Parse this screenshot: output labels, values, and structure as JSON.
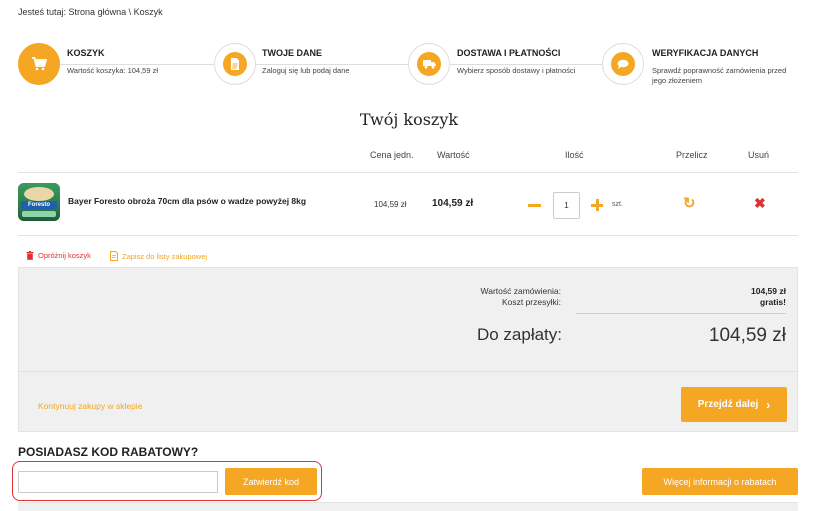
{
  "breadcrumb": {
    "prefix": "Jesteś tutaj:",
    "home": "Strona główna",
    "separator": "\\",
    "current": "Koszyk"
  },
  "steps": [
    {
      "title": "KOSZYK",
      "desc": "Wartość koszyka: 104,59 zł",
      "icon": "cart-icon",
      "active": true
    },
    {
      "title": "TWOJE DANE",
      "desc": "Zaloguj się lub podaj dane",
      "icon": "document-icon",
      "active": false
    },
    {
      "title": "DOSTAWA I PŁATNOŚCI",
      "desc": "Wybierz sposób dostawy i płatności",
      "icon": "truck-icon",
      "active": false
    },
    {
      "title": "WERYFIKACJA DANYCH",
      "desc": "Sprawdź poprawność zamówienia przed jego złożeniem",
      "icon": "speech-bubble-icon",
      "active": false
    }
  ],
  "cart_title": "Twój koszyk",
  "table": {
    "headers": {
      "unit_price": "Cena jedn.",
      "value": "Wartość",
      "quantity": "Ilość",
      "recalc": "Przelicz",
      "remove": "Usuń"
    }
  },
  "items": [
    {
      "name": "Bayer Foresto obroża 70cm dla psów o wadze powyżej 8kg",
      "image_label": "Foresto",
      "unit_price": "104,59 zł",
      "value": "104,59 zł",
      "quantity": "1",
      "unit": "szt."
    }
  ],
  "actions": {
    "empty_cart": "Opróżnij koszyk",
    "save_list": "Zapisz do listy zakupowej"
  },
  "summary": {
    "order_value_label": "Wartość zamówienia:",
    "order_value": "104,59 zł",
    "shipping_label": "Koszt przesyłki:",
    "shipping": "gratis!",
    "to_pay_label": "Do zapłaty:",
    "to_pay": "104,59 zł"
  },
  "continue_shopping": "Kontynuuj zakupy w sklepie",
  "next_button": "Przejdź dalej",
  "promo": {
    "title": "POSIADASZ KOD RABATOWY?",
    "input_value": "",
    "submit": "Zatwierdź kod",
    "more_info": "Więcej informacji o rabatach"
  },
  "colors": {
    "accent": "#f5a623",
    "danger": "#e03131",
    "summary_bg": "#f0f0f0"
  }
}
